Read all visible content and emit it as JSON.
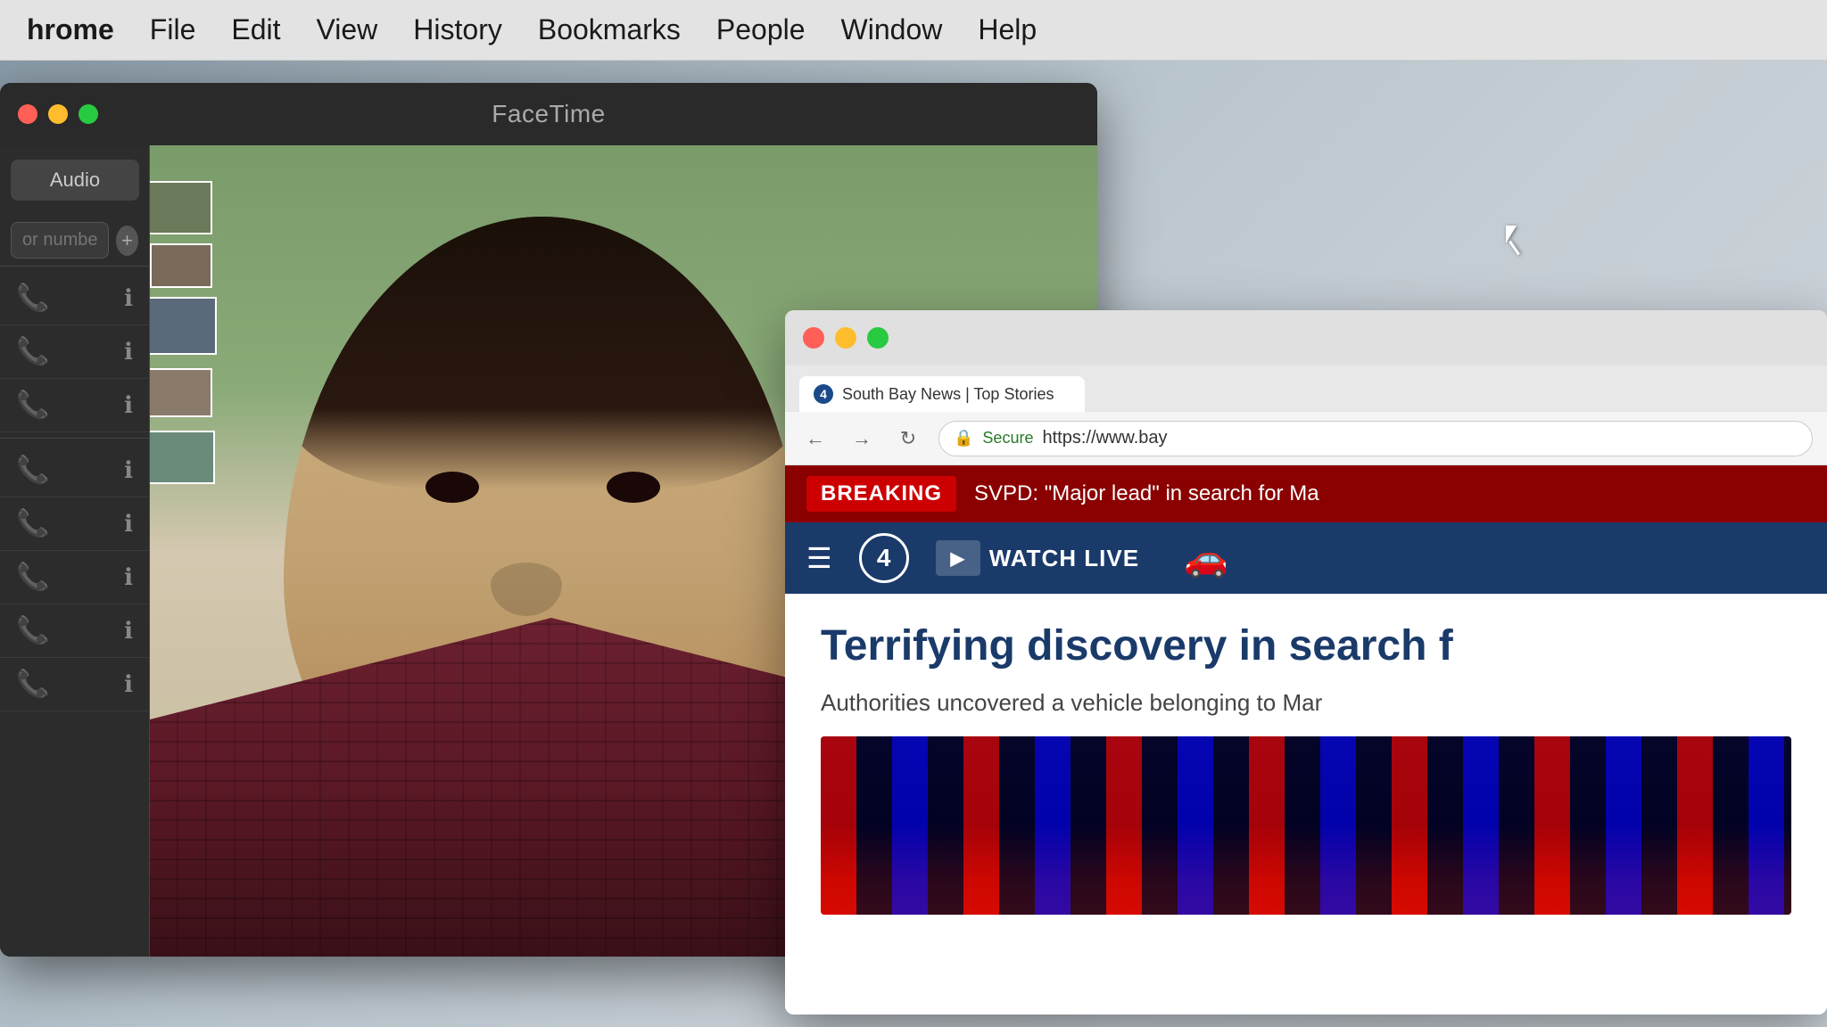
{
  "menubar": {
    "app": "hrome",
    "items": [
      {
        "label": "File"
      },
      {
        "label": "Edit"
      },
      {
        "label": "View"
      },
      {
        "label": "History"
      },
      {
        "label": "Bookmarks"
      },
      {
        "label": "People"
      },
      {
        "label": "Window"
      },
      {
        "label": "Help"
      }
    ]
  },
  "facetime": {
    "title": "FaceTime",
    "audio_button": "Audio",
    "search_placeholder": "or number",
    "contacts": [
      {
        "id": 1
      },
      {
        "id": 2
      },
      {
        "id": 3
      },
      {
        "id": 4
      },
      {
        "id": 5
      },
      {
        "id": 6
      },
      {
        "id": 7
      },
      {
        "id": 8
      }
    ]
  },
  "browser": {
    "tab_title": "South Bay News | Top Stories",
    "tab_favicon_label": "4",
    "nav": {
      "secure_label": "Secure",
      "url": "https://www.bay"
    },
    "breaking_badge": "BREAKING",
    "breaking_text": "SVPD: \"Major lead\" in search for Ma",
    "news_logo": "4",
    "watch_live_label": "WATCH LIVE",
    "headline": "Terrifying discovery in search f",
    "subtitle": "Authorities uncovered a vehicle belonging to Mar"
  }
}
